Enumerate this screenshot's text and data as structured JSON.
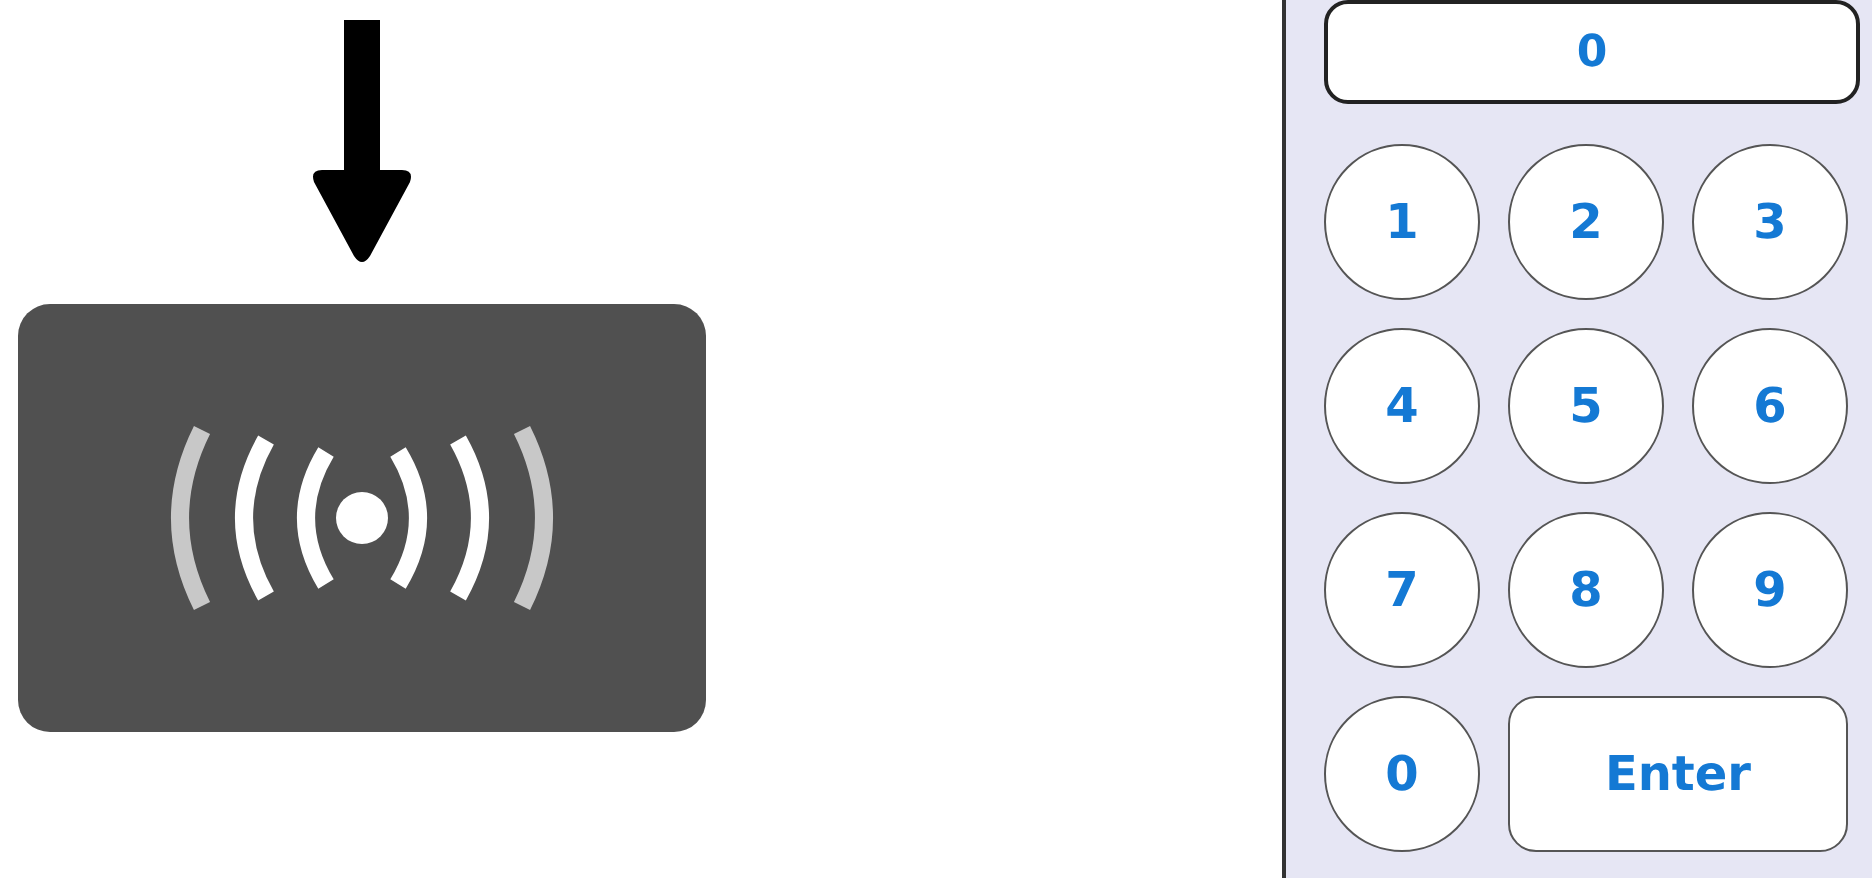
{
  "keypad": {
    "display": "0",
    "keys": [
      {
        "label": "1",
        "kind": "round"
      },
      {
        "label": "2",
        "kind": "round"
      },
      {
        "label": "3",
        "kind": "round"
      },
      {
        "label": "4",
        "kind": "round"
      },
      {
        "label": "5",
        "kind": "round"
      },
      {
        "label": "6",
        "kind": "round"
      },
      {
        "label": "7",
        "kind": "round"
      },
      {
        "label": "8",
        "kind": "round"
      },
      {
        "label": "9",
        "kind": "round"
      },
      {
        "label": "0",
        "kind": "round"
      },
      {
        "label": "Enter",
        "kind": "wide"
      }
    ]
  }
}
